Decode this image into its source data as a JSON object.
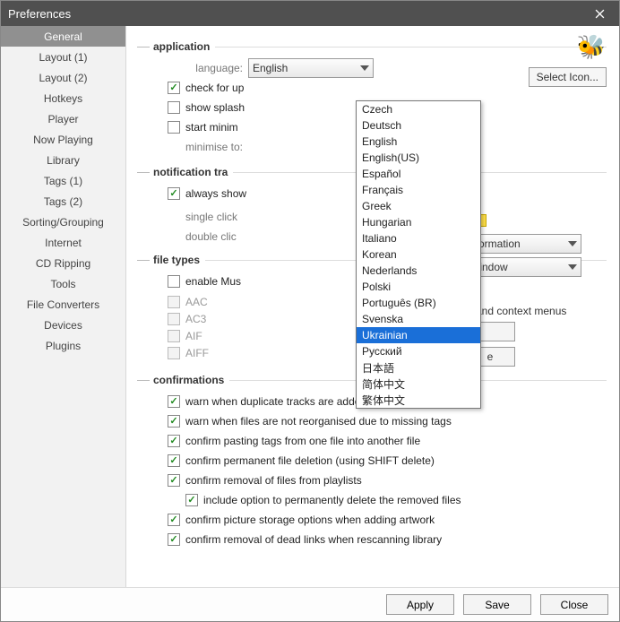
{
  "window": {
    "title": "Preferences"
  },
  "sidebar": {
    "items": [
      {
        "label": "General",
        "active": true
      },
      {
        "label": "Layout (1)"
      },
      {
        "label": "Layout (2)"
      },
      {
        "label": "Hotkeys"
      },
      {
        "label": "Player"
      },
      {
        "label": "Now Playing"
      },
      {
        "label": "Library"
      },
      {
        "label": "Tags (1)"
      },
      {
        "label": "Tags (2)"
      },
      {
        "label": "Sorting/Grouping"
      },
      {
        "label": "Internet"
      },
      {
        "label": "CD Ripping"
      },
      {
        "label": "Tools"
      },
      {
        "label": "File Converters"
      },
      {
        "label": "Devices"
      },
      {
        "label": "Plugins"
      }
    ]
  },
  "sections": {
    "application": {
      "title": "application",
      "language_label": "language:",
      "language_value": "English",
      "check_updates": "check for up",
      "show_splash": "show splash",
      "start_min": "start minim",
      "minimise_to": "minimise to:",
      "select_icon": "Select Icon..."
    },
    "notif": {
      "title": "notification tra",
      "always_show": "always show",
      "single_click": "single click",
      "double_click": "double clic",
      "single_value": "nformation",
      "double_value": "Window"
    },
    "filetypes": {
      "title": "file types",
      "enable": "enable Mus",
      "enable_suffix": "and context menus",
      "types": [
        "AAC",
        "AC3",
        "AIF",
        "AIFF"
      ],
      "btn1": "",
      "btn2": "e"
    },
    "confirm": {
      "title": "confirmations",
      "c1": "warn when duplicate tracks are added to a playlist",
      "c2": "warn when files are not reorganised due to missing tags",
      "c3": "confirm pasting tags from one file into another file",
      "c4": "confirm permanent file deletion (using SHIFT delete)",
      "c5": "confirm removal of files from playlists",
      "c5a": "include option to permanently delete the removed files",
      "c6": "confirm picture storage options when adding artwork",
      "c7": "confirm removal of dead links when rescanning library"
    }
  },
  "dropdown": {
    "options": [
      "Czech",
      "Deutsch",
      "English",
      "English(US)",
      "Español",
      "Français",
      "Greek",
      "Hungarian",
      "Italiano",
      "Korean",
      "Nederlands",
      "Polski",
      "Português (BR)",
      "Svenska",
      "Ukrainian",
      "Русский",
      "日本語",
      "简体中文",
      "繁体中文"
    ],
    "selected": "Ukrainian"
  },
  "footer": {
    "apply": "Apply",
    "save": "Save",
    "close": "Close"
  }
}
